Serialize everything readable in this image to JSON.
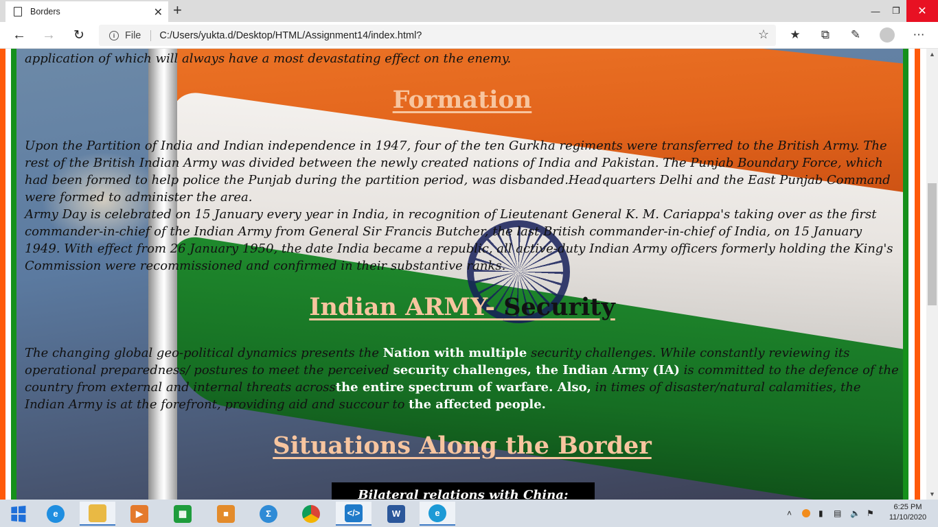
{
  "browser": {
    "tab_title": "Borders",
    "tab_close": "✕",
    "new_tab": "+",
    "file_label": "File",
    "url": "C:/Users/yukta.d/Desktop/HTML/Assignment14/index.html?",
    "window_min": "—",
    "window_max": "❐",
    "window_close": "✕"
  },
  "page": {
    "intro_tail": "application of which will always have a most devastating effect on the enemy.",
    "formation_heading": "Formation",
    "formation_p1": "Upon the Partition of India and Indian independence in 1947, four of the ten Gurkha regiments were transferred to the British Army. The rest of the British Indian Army was divided between the newly created nations of India and Pakistan. The Punjab Boundary Force, which had been formed to help police the Punjab during the partition period, was disbanded.Headquarters Delhi and the East Punjab Command were formed to administer the area.",
    "formation_p2": "Army Day is celebrated on 15 January every year in India, in recognition of Lieutenant General K. M. Cariappa's taking over as the first commander-in-chief of the Indian Army from General Sir Francis Butcher, the last British commander-in-chief of India, on 15 January 1949. With effect from 26 January 1950, the date India became a republic, all active-duty Indian Army officers formerly holding the King's Commission were recommissioned and confirmed in their substantive ranks.",
    "security_heading_a": "Indian ARMY- ",
    "security_heading_b": "Security",
    "security_p_1": "The changing global geo-political dynamics presents the ",
    "security_p_hl1": "Nation with multiple",
    "security_p_2": " security challenges. While constantly reviewing its operational preparedness/ postures to meet the perceived ",
    "security_p_hl2": "security challenges, the Indian Army (IA)",
    "security_p_3": " is committed to the defence of the country from external and internal threats across",
    "security_p_hl3": "the entire spectrum of warfare. Also,",
    "security_p_4": " in times of disaster/natural calamities, the Indian Army is at the forefront, providing aid and succour to ",
    "security_p_hl4": "the affected people.",
    "border_heading": "Situations Along the Border",
    "infobox_title": "Bilateral relations with China:"
  },
  "taskbar": {
    "clock_time": "6:25 PM",
    "clock_date": "11/10/2020"
  },
  "colors": {
    "saffron": "#ff5a0a",
    "green": "#15901b",
    "heading_peach": "#f7c59f",
    "close_red": "#e81123"
  },
  "icons": [
    "page-icon",
    "back-icon",
    "forward-icon",
    "reload-icon",
    "info-icon",
    "favorite-star-icon",
    "favorites-icon",
    "collections-icon",
    "feedback-icon",
    "profile-icon",
    "more-icon",
    "windows-start-icon",
    "ie-icon",
    "file-explorer-icon",
    "edge-icon"
  ]
}
